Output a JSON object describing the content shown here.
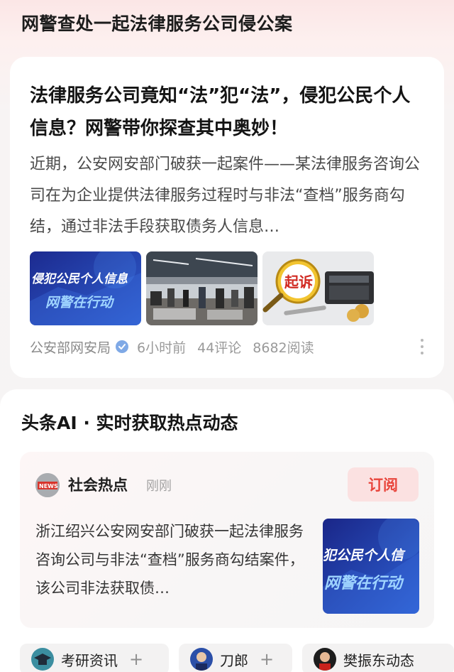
{
  "topic": {
    "header": "网警查处一起法律服务公司侵公案"
  },
  "article": {
    "title": "法律服务公司竟知“法”犯“法”，侵犯公民个人信息？网警带你探查其中奥妙！",
    "excerpt": "近期，公安网安部门破获一起案件——某法律服务咨询公司在为企业提供法律服务过程时与非法“查档”服务商勾结，通过非法手段获取债务人信息…",
    "thumb1_text_top": "侵犯公民个人信息",
    "thumb1_text_bottom": "网警在行动",
    "thumb3_badge": "起诉",
    "source": "公安部网安局",
    "time": "6小时前",
    "comments": "44评论",
    "reads": "8682阅读",
    "colors": {
      "accent": "#e8453c",
      "verify": "#7fa9e6"
    }
  },
  "ai_section": {
    "title": "头条AI · 实时获取热点动态",
    "hot": {
      "avatar_text": "NEWS",
      "name": "社会热点",
      "time": "刚刚",
      "subscribe_label": "订阅",
      "text": "浙江绍兴公安网安部门破获一起法律服务咨询公司与非法“查档”服务商勾结案件，该公司非法获取债…",
      "thumb_text_top": "犯公民个人信",
      "thumb_text_bottom": "网警在行动"
    },
    "chips": [
      {
        "label": "考研资讯",
        "icon": "graduation-cap-icon"
      },
      {
        "label": "刀郎",
        "icon": "singer-avatar-icon"
      },
      {
        "label": "樊振东动态",
        "icon": "athlete-avatar-icon"
      }
    ],
    "chip_add_symbol": "+"
  }
}
